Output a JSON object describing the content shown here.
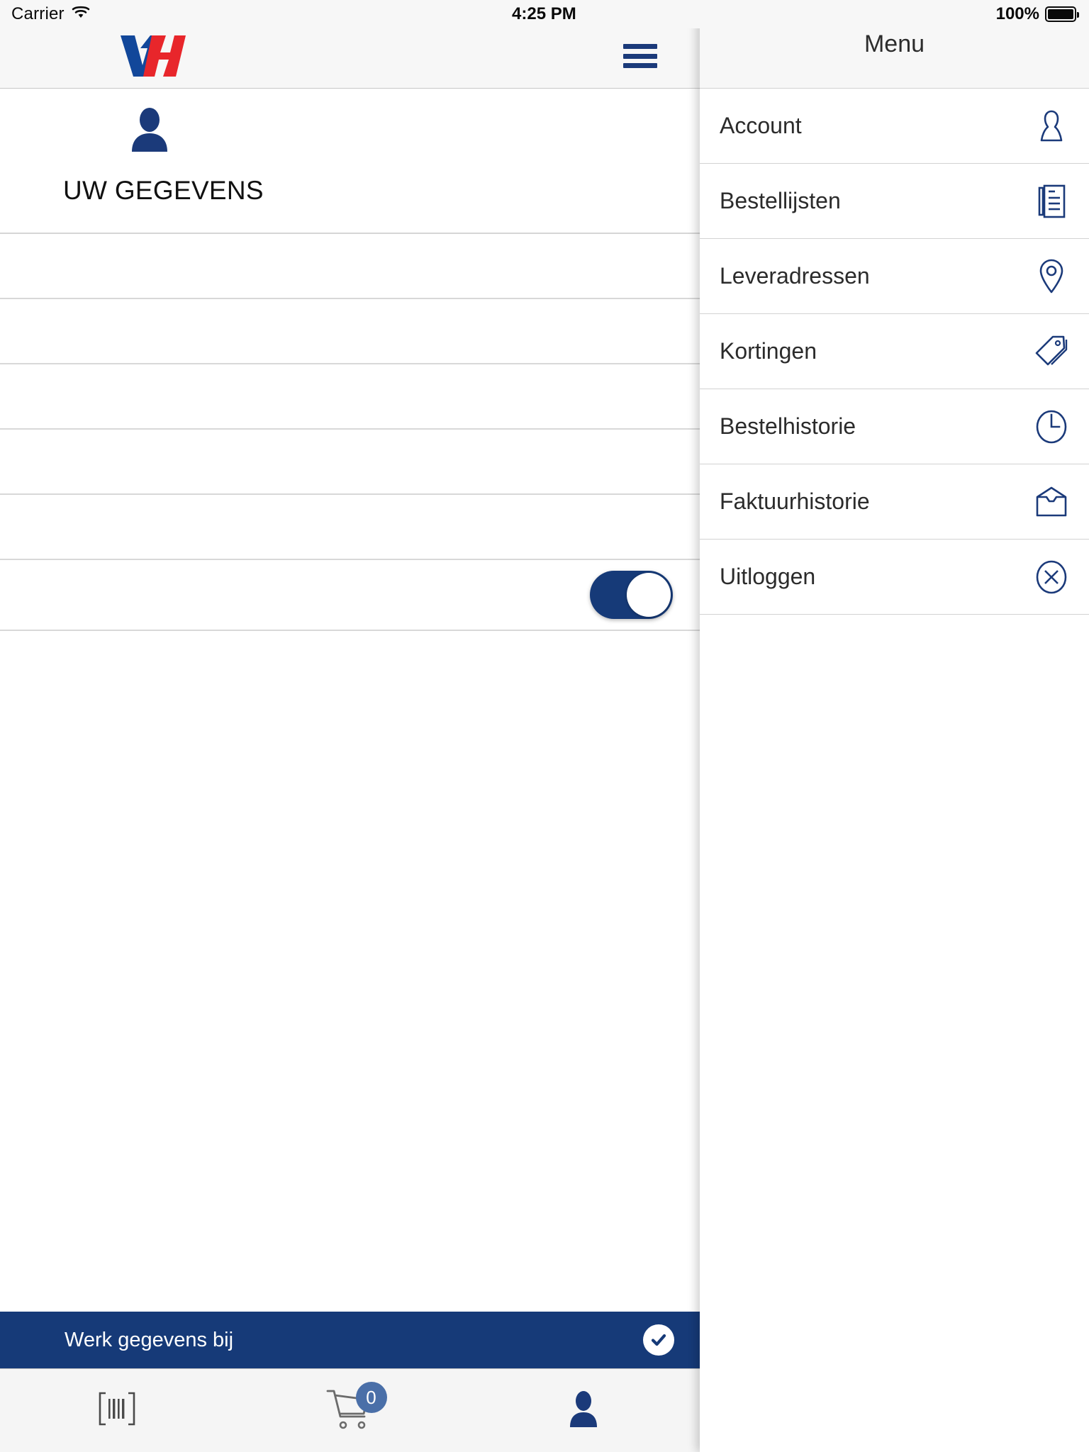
{
  "status_bar": {
    "carrier": "Carrier",
    "wifi_icon": "wifi-icon",
    "time": "4:25 PM",
    "battery_text": "100%",
    "battery_icon": "battery-full-icon"
  },
  "nav": {
    "logo_alt": "vh-logo",
    "menu_icon": "hamburger-menu-icon"
  },
  "profile": {
    "avatar_icon": "person-icon",
    "title": "UW GEGEVENS",
    "fields": [
      {
        "name": "field-1",
        "value": "",
        "type": "text"
      },
      {
        "name": "field-2",
        "value": "",
        "type": "text"
      },
      {
        "name": "field-3",
        "value": "",
        "type": "text"
      },
      {
        "name": "field-4",
        "value": "",
        "type": "text"
      },
      {
        "name": "field-5",
        "value": "",
        "type": "text"
      },
      {
        "name": "field-6",
        "value": "",
        "type": "toggle",
        "toggle_on": true
      }
    ]
  },
  "action_bar": {
    "label": "Werk gegevens bij",
    "confirm_icon": "check-circle-icon"
  },
  "tab_bar": {
    "tabs": [
      {
        "name": "scan",
        "icon": "barcode-icon",
        "badge": ""
      },
      {
        "name": "cart",
        "icon": "shopping-cart-icon",
        "badge": "0"
      },
      {
        "name": "account",
        "icon": "person-icon",
        "badge": ""
      }
    ]
  },
  "drawer": {
    "title": "Menu",
    "items": [
      {
        "label": "Account",
        "icon": "person-outline-icon"
      },
      {
        "label": "Bestellijsten",
        "icon": "list-document-icon"
      },
      {
        "label": "Leveradressen",
        "icon": "map-pin-icon"
      },
      {
        "label": "Kortingen",
        "icon": "price-tag-icon"
      },
      {
        "label": "Bestelhistorie",
        "icon": "clock-icon"
      },
      {
        "label": "Faktuurhistorie",
        "icon": "inbox-icon"
      },
      {
        "label": "Uitloggen",
        "icon": "close-circle-icon"
      }
    ]
  },
  "colors": {
    "brand_blue": "#163a78",
    "brand_red": "#e8262b",
    "bar_background": "#f7f7f7",
    "divider": "#d8d8d8",
    "badge_blue": "#4a6fa8"
  }
}
